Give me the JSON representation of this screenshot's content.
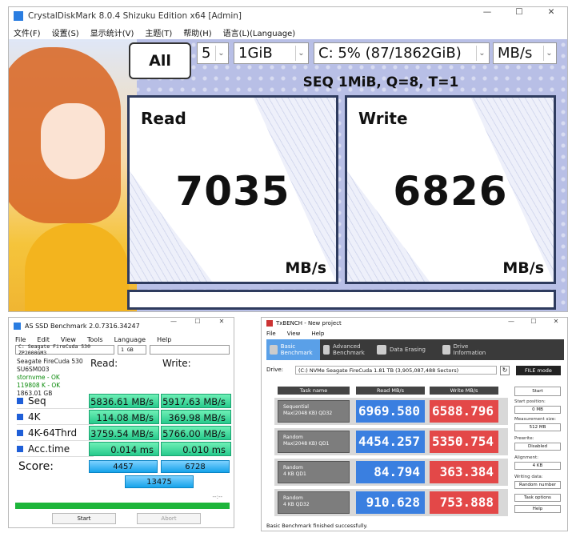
{
  "cdm": {
    "title": "CrystalDiskMark 8.0.4 Shizuku Edition x64 [Admin]",
    "menu": [
      "文件(F)",
      "设置(S)",
      "显示统计(V)",
      "主题(T)",
      "帮助(H)",
      "语言(L)(Language)"
    ],
    "all_label": "All",
    "count": "5",
    "size": "1GiB",
    "drive": "C: 5% (87/1862GiB)",
    "unit": "MB/s",
    "mode": "SEQ 1MiB, Q=8, T=1",
    "read": {
      "label": "Read",
      "value": "7035",
      "unit": "MB/s"
    },
    "write": {
      "label": "Write",
      "value": "6826",
      "unit": "MB/s"
    }
  },
  "asssd": {
    "title": "AS SSD Benchmark 2.0.7316.34247",
    "menu": [
      "File",
      "Edit",
      "View",
      "Tools",
      "Language",
      "Help"
    ],
    "drive_select": "C: Seagate FireCuda 530 ZP2000GM3",
    "size_select": "1 GB",
    "info": [
      "Seagate FireCuda 530",
      "SU6SM003",
      "stornvme - OK",
      "119808 K - OK",
      "1863.01 GB"
    ],
    "read_header": "Read:",
    "write_header": "Write:",
    "rows": [
      {
        "label": "Seq",
        "read": "5836.61 MB/s",
        "write": "5917.63 MB/s"
      },
      {
        "label": "4K",
        "read": "114.08 MB/s",
        "write": "369.98 MB/s"
      },
      {
        "label": "4K-64Thrd",
        "read": "3759.54 MB/s",
        "write": "5766.00 MB/s"
      },
      {
        "label": "Acc.time",
        "read": "0.014 ms",
        "write": "0.010 ms"
      }
    ],
    "score_label": "Score:",
    "score_read": "4457",
    "score_write": "6728",
    "score_total": "13475",
    "progress_text": "--:--",
    "start": "Start",
    "abort": "Abort"
  },
  "txb": {
    "title": "TxBENCH - New project",
    "menu": [
      "File",
      "View",
      "Help"
    ],
    "tabs": [
      {
        "label": "Basic Benchmark"
      },
      {
        "label": "Advanced Benchmark"
      },
      {
        "label": "Data Erasing"
      },
      {
        "label": "Drive Information"
      }
    ],
    "drive_label": "Drive:",
    "drive_value": "(C:) NVMe Seagate FireCuda  1.81 TB (3,905,087,488 Sectors)",
    "file_mode": "FILE mode",
    "col_task": "Task name",
    "col_read": "Read MB/s",
    "col_write": "Write MB/s",
    "rows": [
      {
        "name": "Sequential",
        "sub": "Max(2048 KB) QD32",
        "read": "6969.580",
        "write": "6588.796"
      },
      {
        "name": "Random",
        "sub": "Max(2048 KB) QD1",
        "read": "4454.257",
        "write": "5350.754"
      },
      {
        "name": "Random",
        "sub": "4 KB QD1",
        "read": "84.794",
        "write": "363.384"
      },
      {
        "name": "Random",
        "sub": "4 KB QD32",
        "read": "910.628",
        "write": "753.888"
      }
    ],
    "start": "Start",
    "start_pos_label": "Start position:",
    "start_pos": "0 MB",
    "meas_label": "Measurement size:",
    "meas": "512 MB",
    "pre_label": "Prewrite:",
    "pre": "Disabled",
    "align_label": "Alignment:",
    "align": "4 KB",
    "wd_label": "Writing data:",
    "wd": "Random number",
    "task_opts": "Task options",
    "help": "Help",
    "status": "Basic Benchmark finished successfully."
  }
}
